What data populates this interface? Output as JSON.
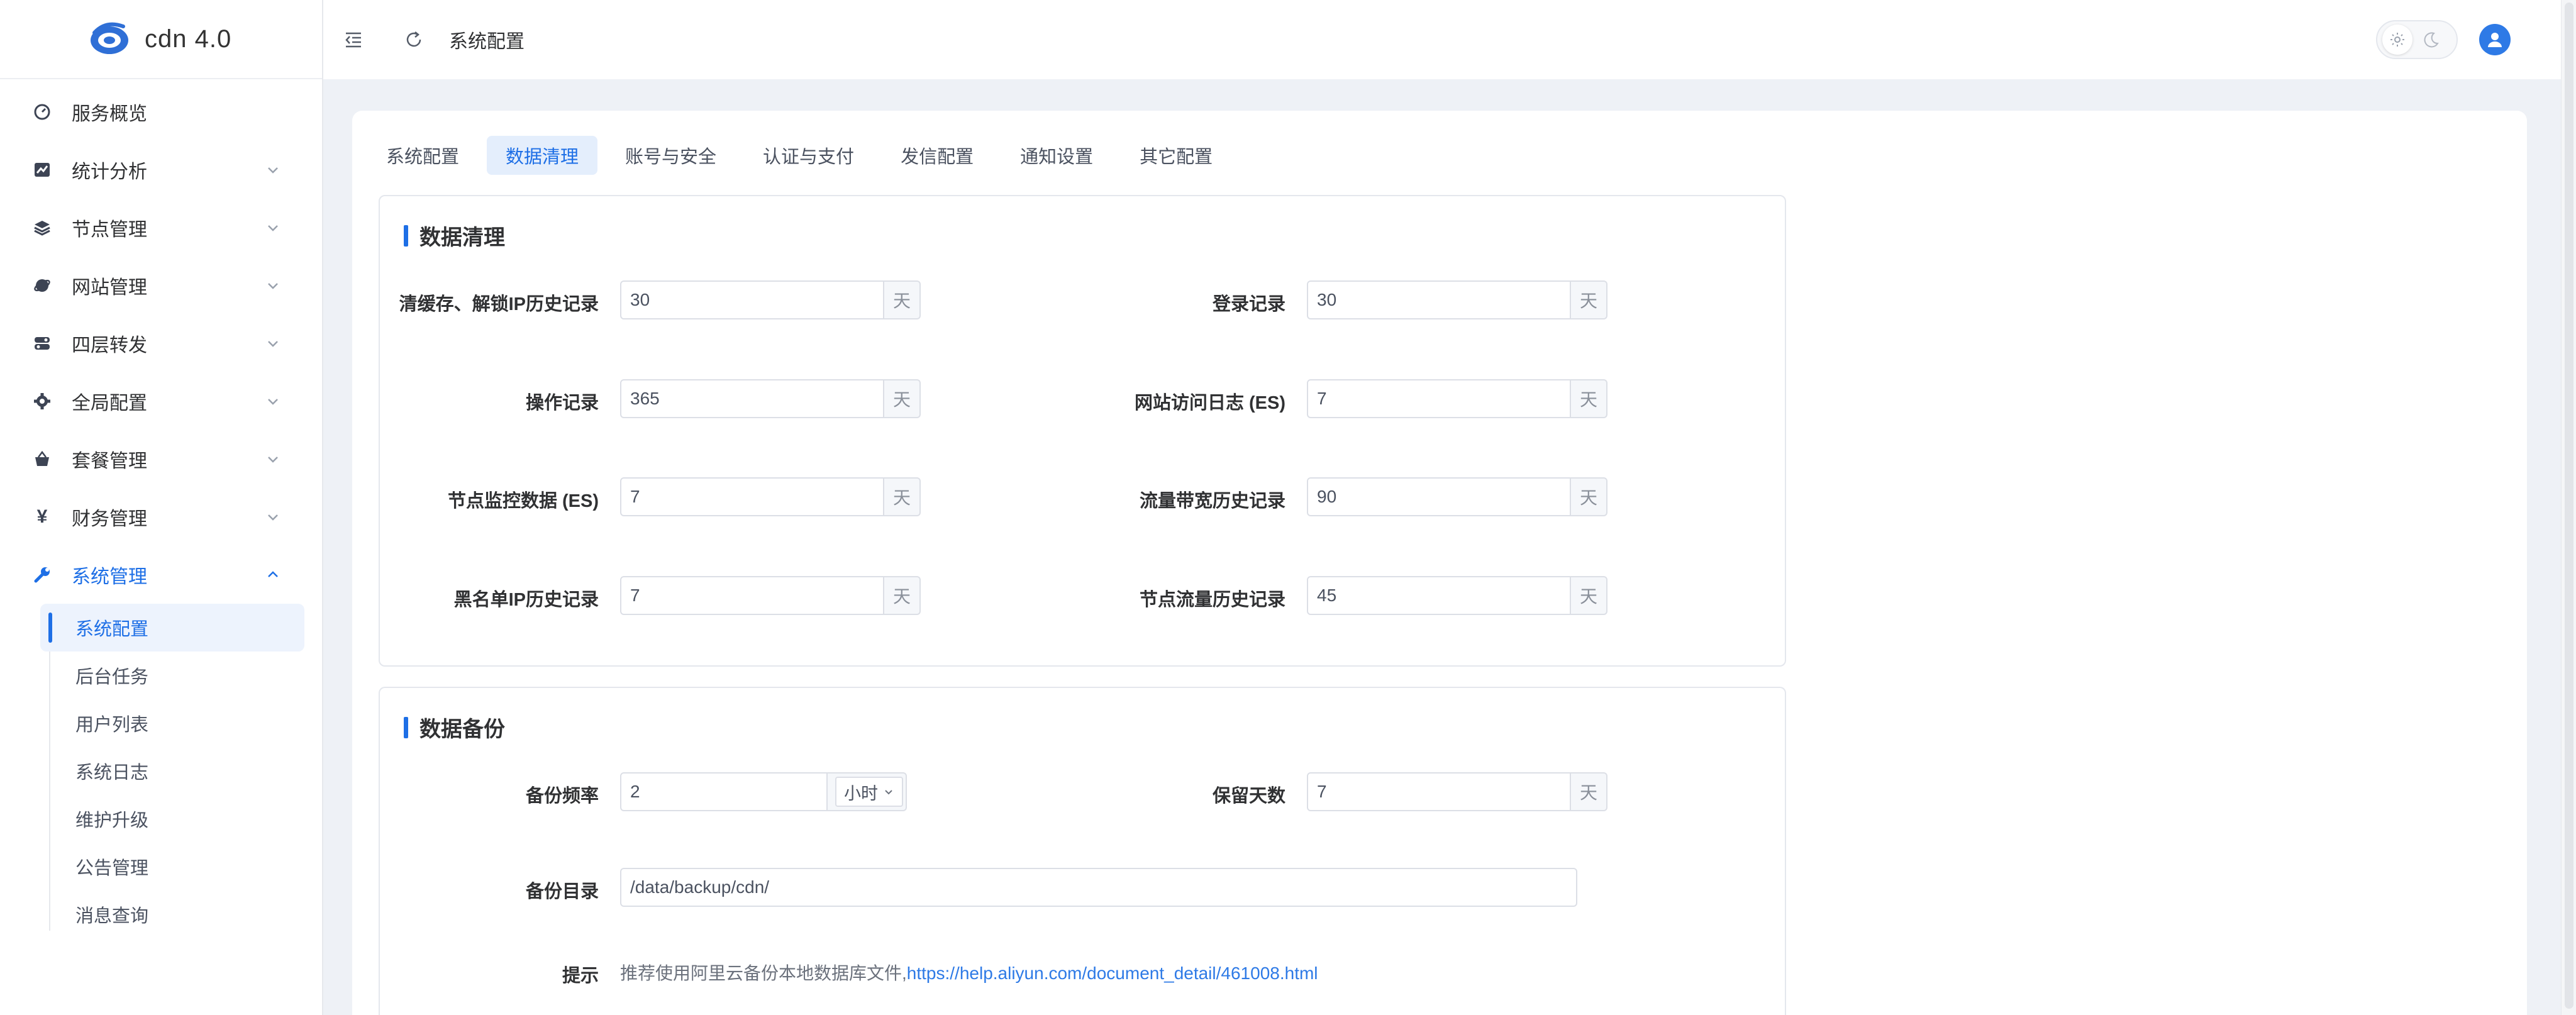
{
  "app": {
    "logo_text": "cdn 4.0"
  },
  "header": {
    "breadcrumb": "系统配置"
  },
  "sidebar": {
    "items": [
      {
        "label": "服务概览",
        "icon": "dashboard-icon",
        "expandable": false
      },
      {
        "label": "统计分析",
        "icon": "chart-icon",
        "expandable": true
      },
      {
        "label": "节点管理",
        "icon": "layers-icon",
        "expandable": true
      },
      {
        "label": "网站管理",
        "icon": "globe-icon",
        "expandable": true
      },
      {
        "label": "四层转发",
        "icon": "forward-icon",
        "expandable": true
      },
      {
        "label": "全局配置",
        "icon": "gear-icon",
        "expandable": true
      },
      {
        "label": "套餐管理",
        "icon": "basket-icon",
        "expandable": true
      },
      {
        "label": "财务管理",
        "icon": "yen-icon",
        "expandable": true
      },
      {
        "label": "系统管理",
        "icon": "wrench-icon",
        "expandable": true,
        "expanded": true
      }
    ],
    "submenu": [
      {
        "label": "系统配置",
        "active": true
      },
      {
        "label": "后台任务"
      },
      {
        "label": "用户列表"
      },
      {
        "label": "系统日志"
      },
      {
        "label": "维护升级"
      },
      {
        "label": "公告管理"
      },
      {
        "label": "消息查询"
      }
    ]
  },
  "tabs": [
    "系统配置",
    "数据清理",
    "账号与安全",
    "认证与支付",
    "发信配置",
    "通知设置",
    "其它配置"
  ],
  "active_tab": "数据清理",
  "cleanup": {
    "title": "数据清理",
    "unit": "天",
    "fields": {
      "cache_ip_history": {
        "label": "清缓存、解锁IP历史记录",
        "value": "30"
      },
      "login_records": {
        "label": "登录记录",
        "value": "30"
      },
      "operation_records": {
        "label": "操作记录",
        "value": "365"
      },
      "site_access_log": {
        "label": "网站访问日志 (ES)",
        "value": "7"
      },
      "node_monitor": {
        "label": "节点监控数据 (ES)",
        "value": "7"
      },
      "bandwidth_history": {
        "label": "流量带宽历史记录",
        "value": "90"
      },
      "blacklist_history": {
        "label": "黑名单IP历史记录",
        "value": "7"
      },
      "node_traffic_history": {
        "label": "节点流量历史记录",
        "value": "45"
      }
    }
  },
  "backup": {
    "title": "数据备份",
    "frequency": {
      "label": "备份频率",
      "value": "2",
      "unit": "小时"
    },
    "retention": {
      "label": "保留天数",
      "value": "7",
      "unit": "天"
    },
    "directory": {
      "label": "备份目录",
      "value": "/data/backup/cdn/"
    },
    "tip": {
      "label": "提示",
      "text": "推荐使用阿里云备份本地数据库文件,",
      "link": "https://help.aliyun.com/document_detail/461008.html"
    }
  },
  "colors": {
    "accent": "#1e6fe6",
    "background": "#eef1f6"
  }
}
